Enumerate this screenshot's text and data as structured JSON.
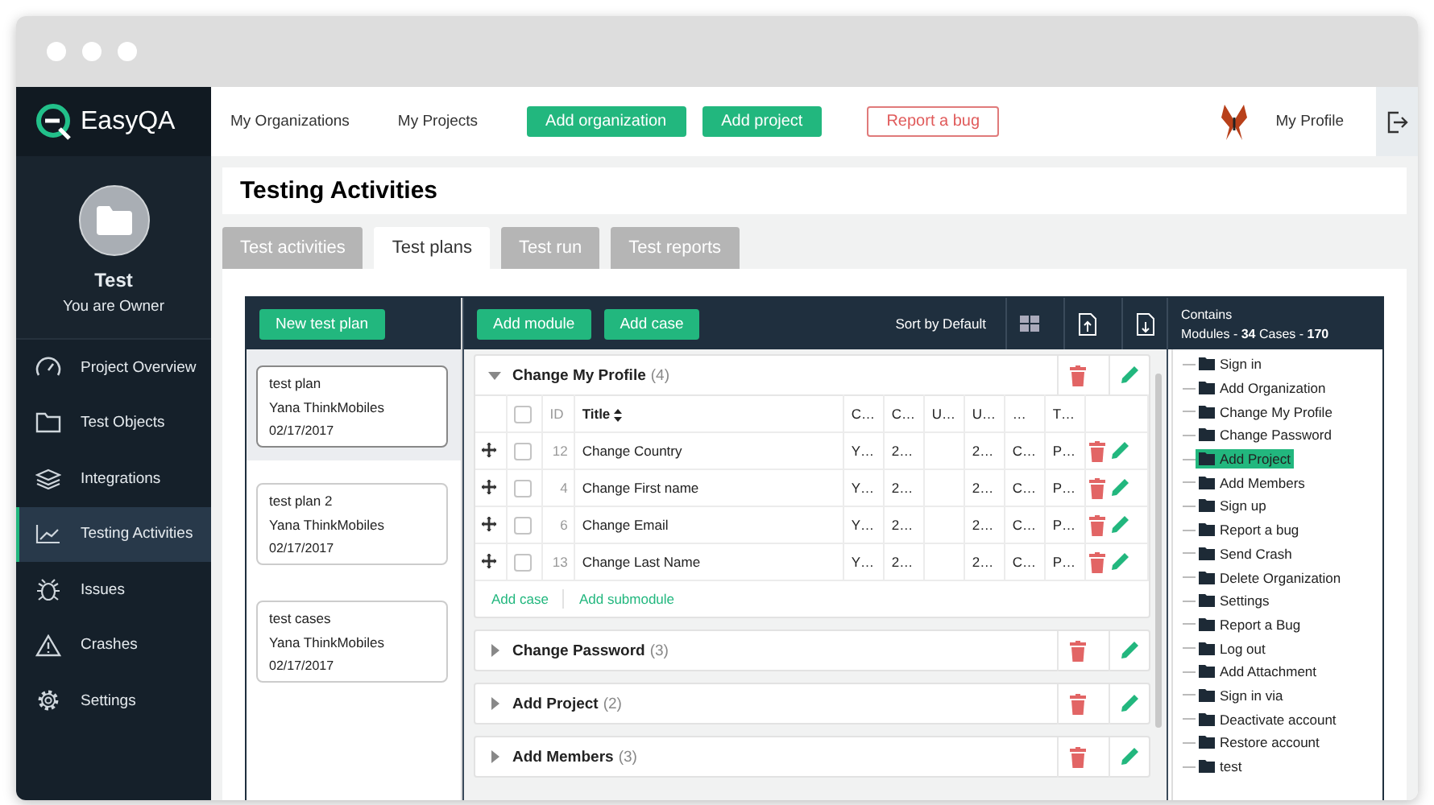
{
  "app": {
    "name": "EasyQA"
  },
  "topbar": {
    "links": [
      "My Organizations",
      "My Projects"
    ],
    "buttons": [
      {
        "label": "Add organization",
        "kind": "primary"
      },
      {
        "label": "Add project",
        "kind": "primary"
      },
      {
        "label": "Report a bug",
        "kind": "outline"
      }
    ],
    "profile": "My Profile"
  },
  "project": {
    "name": "Test",
    "role": "You are Owner"
  },
  "sidebar": {
    "items": [
      {
        "label": "Project Overview",
        "selected": false
      },
      {
        "label": "Test Objects",
        "selected": false
      },
      {
        "label": "Integrations",
        "selected": false
      },
      {
        "label": "Testing Activities",
        "selected": true
      },
      {
        "label": "Issues",
        "selected": false
      },
      {
        "label": "Crashes",
        "selected": false
      },
      {
        "label": "Settings",
        "selected": false
      }
    ]
  },
  "page": {
    "title": "Testing Activities"
  },
  "tabs": [
    {
      "label": "Test activities",
      "selected": false
    },
    {
      "label": "Test plans",
      "selected": true
    },
    {
      "label": "Test run",
      "selected": false
    },
    {
      "label": "Test reports",
      "selected": false
    }
  ],
  "toolbar": {
    "new_plan": "New test plan",
    "add_module": "Add module",
    "add_case": "Add case",
    "sort": "Sort by Default"
  },
  "plans": [
    {
      "title": "test plan",
      "author": "Yana ThinkMobiles",
      "date": "02/17/2017",
      "selected": true
    },
    {
      "title": "test plan 2",
      "author": "Yana ThinkMobiles",
      "date": "02/17/2017",
      "selected": false
    },
    {
      "title": "test cases",
      "author": "Yana ThinkMobiles",
      "date": "02/17/2017",
      "selected": false
    }
  ],
  "modules": [
    {
      "name": "Change My Profile",
      "count": "(4)",
      "expanded": true,
      "table": {
        "select_all_checked": false,
        "columns": [
          "ID",
          "Title",
          "C…",
          "C…",
          "U…",
          "U…",
          "…",
          "T…"
        ],
        "rows": [
          {
            "cells": [
              "12",
              "Change Country",
              "Y…",
              "2…",
              "",
              "2…",
              "C…",
              "P…"
            ],
            "checked": false
          },
          {
            "cells": [
              "4",
              "Change First name",
              "Y…",
              "2…",
              "",
              "2…",
              "C…",
              "P…"
            ],
            "checked": false
          },
          {
            "cells": [
              "6",
              "Change Email",
              "Y…",
              "2…",
              "",
              "2…",
              "C…",
              "P…"
            ],
            "checked": false
          },
          {
            "cells": [
              "13",
              "Change Last Name",
              "Y…",
              "2…",
              "",
              "2…",
              "C…",
              "P…"
            ],
            "checked": false
          }
        ]
      },
      "links": [
        "Add case",
        "Add submodule"
      ]
    },
    {
      "name": "Change Password",
      "count": "(3)",
      "expanded": false
    },
    {
      "name": "Add Project",
      "count": "(2)",
      "expanded": false
    },
    {
      "name": "Add Members",
      "count": "(3)",
      "expanded": false
    }
  ],
  "tree": {
    "heading": "Contains",
    "summary": "Modules - **34** Cases - **170**",
    "items": [
      {
        "label": "Sign in",
        "selected": false
      },
      {
        "label": "Add Organization",
        "selected": false
      },
      {
        "label": "Change My Profile",
        "selected": false
      },
      {
        "label": "Change Password",
        "selected": false
      },
      {
        "label": "Add Project",
        "selected": true
      },
      {
        "label": "Add Members",
        "selected": false
      },
      {
        "label": "Sign up",
        "selected": false
      },
      {
        "label": "Report a bug",
        "selected": false
      },
      {
        "label": "Send Crash",
        "selected": false
      },
      {
        "label": "Delete Organization",
        "selected": false
      },
      {
        "label": "Settings",
        "selected": false
      },
      {
        "label": "Report a Bug",
        "selected": false
      },
      {
        "label": "Log out",
        "selected": false
      },
      {
        "label": "Add Attachment",
        "selected": false
      },
      {
        "label": "Sign in via",
        "selected": false
      },
      {
        "label": "Deactivate account",
        "selected": false
      },
      {
        "label": "Restore account",
        "selected": false
      },
      {
        "label": "test",
        "selected": false
      }
    ]
  }
}
